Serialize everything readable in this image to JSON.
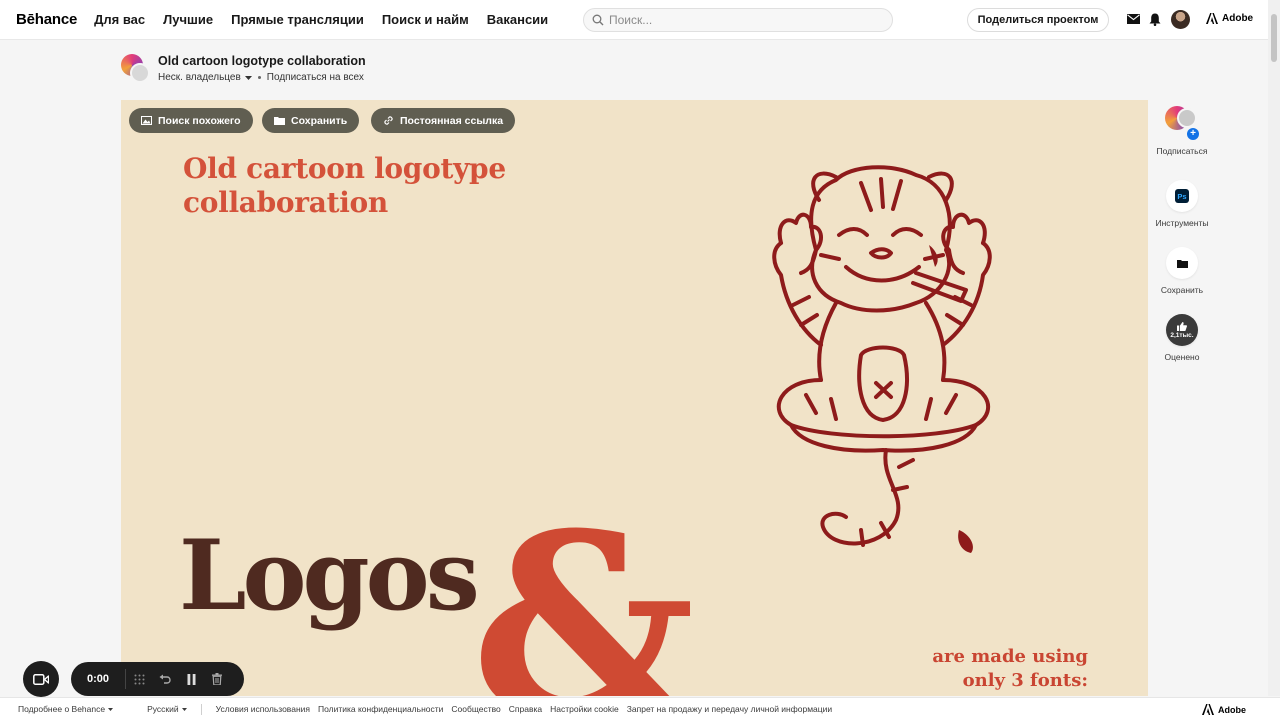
{
  "nav": {
    "logo": "Bēhance",
    "links": [
      "Для вас",
      "Лучшие",
      "Прямые трансляции",
      "Поиск и найм",
      "Вакансии"
    ],
    "search_placeholder": "Поиск...",
    "share_label": "Поделиться проектом",
    "adobe_label": "Adobe",
    "icons": [
      "search-icon",
      "mail-icon",
      "bell-icon",
      "user-avatar",
      "adobe-icon"
    ]
  },
  "project": {
    "title": "Old cartoon logotype collaboration",
    "owners_label": "Неск. владельцев",
    "follow_all_label": "Подписаться на всех"
  },
  "image_actions": {
    "similar_label": "Поиск похожего",
    "save_label": "Сохранить",
    "permalink_label": "Постоянная ссылка"
  },
  "artwork": {
    "title_line1": "Old cartoon logotype",
    "title_line2": "collaboration",
    "logos_text": "Logos",
    "amp_text": "&",
    "fonts_line1": "are made using",
    "fonts_line2": "only 3 fonts:"
  },
  "rail": {
    "follow_label": "Подписаться",
    "tools_label": "Инструменты",
    "tools_badge": "Ps",
    "save_label": "Сохранить",
    "appreciate_label": "Оценено",
    "appreciate_count": "2,1тыс."
  },
  "recorder": {
    "time": "0:00"
  },
  "footer": {
    "more_label": "Подробнее о Behance",
    "language_label": "Русский",
    "links": [
      "Условия использования",
      "Политика конфиденциальности",
      "Сообщество",
      "Справка",
      "Настройки cookie",
      "Запрет на продажу и передачу личной информации"
    ],
    "adobe_label": "Adobe"
  },
  "colors": {
    "canvas_bg": "#f1e3c8",
    "title_red": "#d4523a",
    "logos_brown": "#4f2a20",
    "tiger_line": "#8e1b1b",
    "accent_blue": "#1473e6"
  }
}
